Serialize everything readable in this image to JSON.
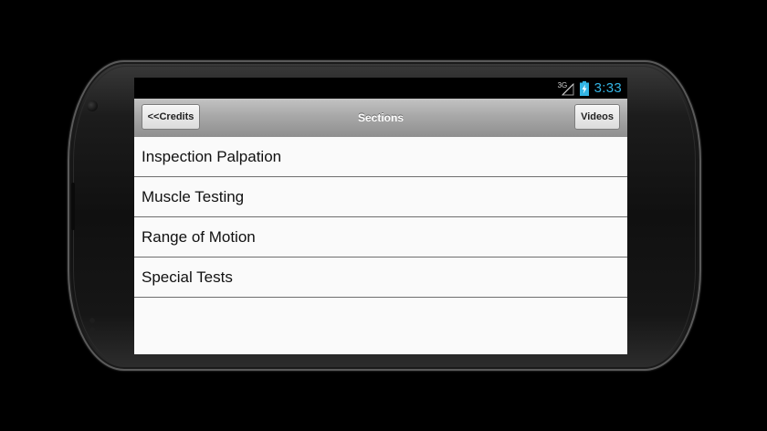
{
  "status_bar": {
    "network_label": "3G",
    "clock": "3:33",
    "clock_color": "#33b5e5",
    "icons": [
      "signal-icon",
      "battery-charging-icon"
    ]
  },
  "action_bar": {
    "title": "Sections",
    "left_button_label": "<<Credits",
    "right_button_label": "Videos"
  },
  "sections": {
    "items": [
      {
        "label": "Inspection Palpation"
      },
      {
        "label": "Muscle Testing"
      },
      {
        "label": "Range of Motion"
      },
      {
        "label": "Special Tests"
      }
    ]
  }
}
